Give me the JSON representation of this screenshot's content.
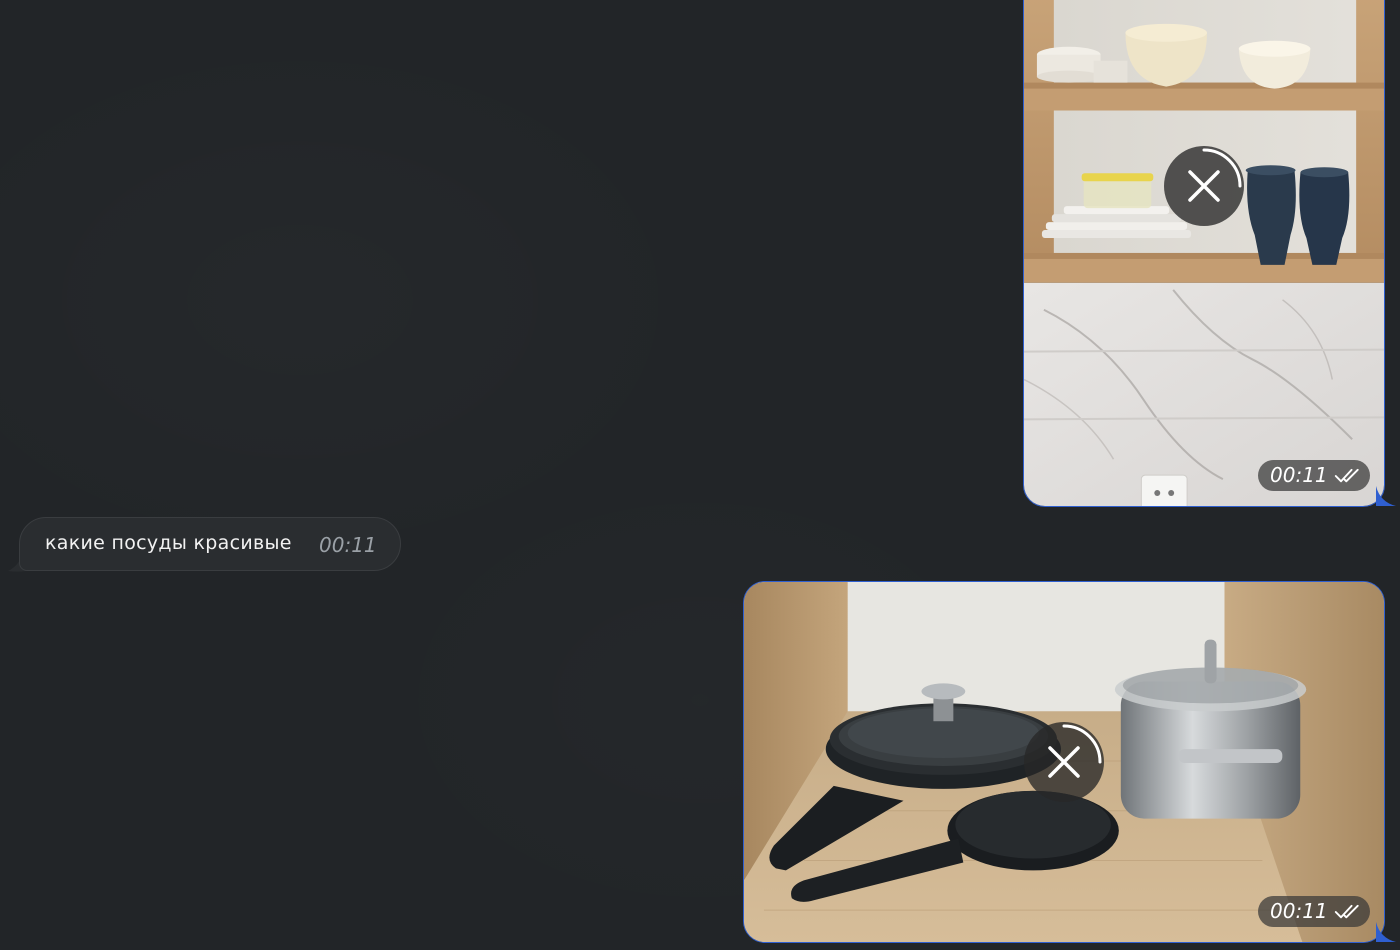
{
  "messages": [
    {
      "type": "outgoing-photo",
      "subject": "kitchen shelves with dishes",
      "time": "00:11",
      "status": "read",
      "upload_state": "uploading"
    },
    {
      "type": "incoming-text",
      "text": "какие посуды красивые",
      "time": "00:11"
    },
    {
      "type": "outgoing-photo",
      "subject": "pots and pans on shelf",
      "time": "00:11",
      "status": "read",
      "upload_state": "uploading"
    }
  ],
  "icons": {
    "cancel": "close-icon",
    "read_status": "double-check-icon"
  },
  "colors": {
    "background": "#222528",
    "outgoing_border": "#2f5fd0",
    "incoming_bubble": "#2a2d30",
    "time_muted": "#9aa0a6"
  }
}
